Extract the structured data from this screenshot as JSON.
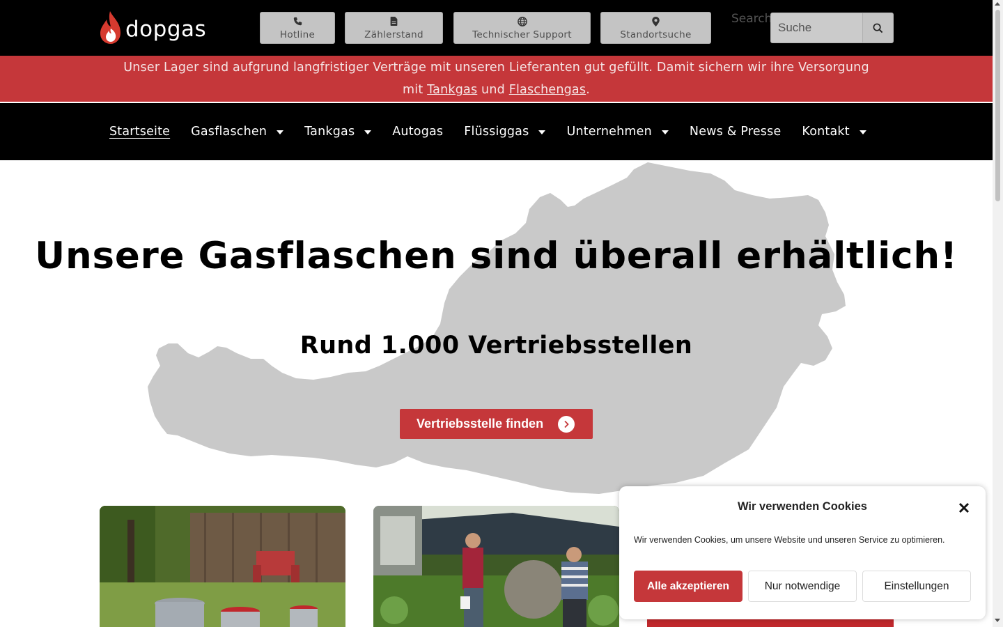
{
  "header": {
    "logo_text": "dopgas",
    "quick_links": [
      {
        "label": "Hotline",
        "icon": "phone-icon"
      },
      {
        "label": "Zählerstand",
        "icon": "document-icon"
      },
      {
        "label": "Technischer Support",
        "icon": "globe-icon"
      },
      {
        "label": "Standortsuche",
        "icon": "location-pin-icon"
      }
    ],
    "search": {
      "label": "Search",
      "placeholder": "Suche",
      "icon": "search-icon"
    }
  },
  "notice": {
    "text_before": "Unser Lager sind aufgrund langfristiger Verträge mit unseren Lieferanten gut gefüllt. Damit sichern wir ihre Versorgung mit ",
    "link_tankgas": "Tankgas",
    "text_between": " und ",
    "link_flaschengas": "Flaschengas",
    "text_after": ".",
    "color": "#c5373a"
  },
  "nav": {
    "items": [
      {
        "label": "Startseite",
        "has_dropdown": false
      },
      {
        "label": "Gasflaschen",
        "has_dropdown": true
      },
      {
        "label": "Tankgas",
        "has_dropdown": true
      },
      {
        "label": "Autogas",
        "has_dropdown": false
      },
      {
        "label": "Flüssiggas",
        "has_dropdown": true
      },
      {
        "label": "Unternehmen",
        "has_dropdown": true
      },
      {
        "label": "News & Presse",
        "has_dropdown": false
      },
      {
        "label": "Kontakt",
        "has_dropdown": true
      }
    ]
  },
  "hero": {
    "title": "Unsere Gasflaschen sind überall erhältlich!",
    "subtitle": "Rund 1.000 Vertriebsstellen",
    "cta_label": "Vertriebsstelle finden",
    "cta_icon": "chevron-right-circle-icon"
  },
  "cookie": {
    "title": "Wir verwenden Cookies",
    "text": "Wir verwenden Cookies, um unsere Website und unseren Service zu optimieren.",
    "accept_label": "Alle akzeptieren",
    "necessary_label": "Nur notwendige",
    "settings_label": "Einstellungen",
    "close_icon": "close-icon"
  },
  "colors": {
    "brand_red": "#c5373a",
    "header_bg": "#000000",
    "map_gray": "#c8c8c8"
  }
}
